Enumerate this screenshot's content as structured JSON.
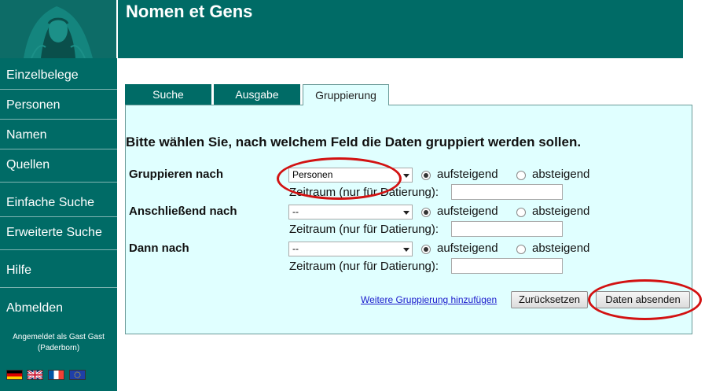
{
  "header": {
    "title": "Nomen et Gens"
  },
  "sidebar": {
    "items": [
      {
        "label": "Einzelbelege"
      },
      {
        "label": "Personen"
      },
      {
        "label": "Namen"
      },
      {
        "label": "Quellen"
      },
      {
        "label": "Einfache Suche"
      },
      {
        "label": "Erweiterte Suche"
      },
      {
        "label": "Hilfe"
      },
      {
        "label": "Abmelden"
      }
    ],
    "login_line1": "Angemeldet als Gast Gast",
    "login_line2": "(Paderborn)",
    "flags": [
      "de",
      "en",
      "fr",
      "eu"
    ]
  },
  "tabs": [
    {
      "label": "Suche"
    },
    {
      "label": "Ausgabe"
    },
    {
      "label": "Gruppierung"
    }
  ],
  "form": {
    "instruction": "Bitte wählen Sie, nach welchem Feld die Daten gruppiert werden sollen.",
    "rows": [
      {
        "label": "Gruppieren nach",
        "selected": "Personen",
        "order": "aufsteigend"
      },
      {
        "label": "Anschließend nach",
        "selected": "--",
        "order": "aufsteigend"
      },
      {
        "label": "Dann nach",
        "selected": "--",
        "order": "aufsteigend"
      }
    ],
    "asc_label": "aufsteigend",
    "desc_label": "absteigend",
    "zeitraum_label": "Zeitraum (nur für Datierung):",
    "zeitraum_value": "",
    "more_link": "Weitere Gruppierung hinzufügen",
    "reset_button": "Zurücksetzen",
    "submit_button": "Daten absenden"
  },
  "colors": {
    "primary": "#006b66",
    "panel": "#e0ffff",
    "annotation": "#d21212",
    "link": "#1a1acc"
  }
}
